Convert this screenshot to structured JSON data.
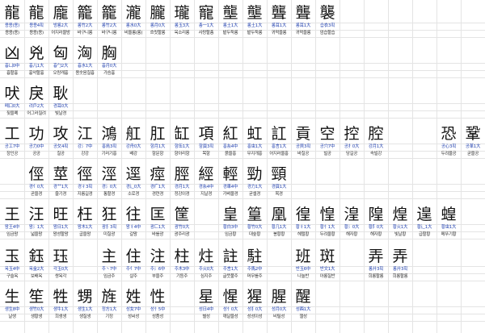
{
  "rows": [
    {
      "cells": [
        {
          "ch": "龍",
          "rd": "용용(용)",
          "mn": "용용(용)"
        },
        {
          "ch": "龍",
          "rd": "용용4획",
          "mn": "용용(용)"
        },
        {
          "ch": "龐",
          "rd": "방룡2大",
          "mn": "어지러울방"
        },
        {
          "ch": "籠",
          "rd": "롱竹2大",
          "mn": "바구니롱"
        },
        {
          "ch": "籠",
          "rd": "롱竹2大",
          "mn": "바구니롱"
        },
        {
          "ch": "瀧",
          "rd": "롱水0大",
          "mn": "비올롱(롱)"
        },
        {
          "ch": "朧",
          "rd": "롱月0大",
          "mn": "흐릿할롱"
        },
        {
          "ch": "瓏",
          "rd": "롱玉3大",
          "mn": "옥소리롱"
        },
        {
          "ch": "寵",
          "rd": "총一1大",
          "mn": "사랑할총"
        },
        {
          "ch": "壟",
          "rd": "롱土1大",
          "mn": "밭두둑롱"
        },
        {
          "ch": "壟",
          "rd": "롱土1大",
          "mn": "밭두둑롱"
        },
        {
          "ch": "聾",
          "rd": "롱耳1大",
          "mn": "귀먹을롱"
        },
        {
          "ch": "聾",
          "rd": "롱耳1大",
          "mn": "귀먹을롱"
        },
        {
          "ch": "襲",
          "rd": "습衣3획",
          "mn": "엄습할습"
        }
      ]
    },
    {
      "cells": [
        {
          "ch": "凶",
          "rd": "흉凵0中",
          "mn": "흉할흉"
        },
        {
          "ch": "兇",
          "rd": "흉儿1大",
          "mn": "흉악할흉"
        },
        {
          "ch": "匈",
          "rd": "흉勹2大",
          "mn": "오랑캐흉"
        },
        {
          "ch": "洶",
          "rd": "흉水1大",
          "mn": "용솟음칠흉"
        },
        {
          "ch": "胸",
          "rd": "흉月0大",
          "mn": "가슴흉"
        }
      ]
    },
    {
      "cells": [
        {
          "ch": "吠",
          "rd": "폐口0大",
          "mn": "짖을폐"
        },
        {
          "ch": "戾",
          "rd": "려戶2大",
          "mn": "어그러질려"
        },
        {
          "ch": "耿",
          "rd": "경耳0大",
          "mn": "빛날경"
        }
      ]
    },
    {
      "cells": [
        {
          "ch": "工",
          "rd": "공工7中",
          "mn": "장인공"
        },
        {
          "ch": "功",
          "rd": "공力0中",
          "mn": "공공"
        },
        {
          "ch": "攻",
          "rd": "공攵4획",
          "mn": "칠공"
        },
        {
          "ch": "江",
          "rd": "강氵7中",
          "mn": "강강"
        },
        {
          "ch": "鴻",
          "rd": "홍鳥3획",
          "mn": "기러기홍"
        },
        {
          "ch": "舡",
          "rd": "강舟0大",
          "mn": "배강"
        },
        {
          "ch": "肛",
          "rd": "항月1大",
          "mn": "항문항"
        },
        {
          "ch": "缸",
          "rd": "항缶1大",
          "mn": "항아리항"
        },
        {
          "ch": "項",
          "rd": "항頁3획",
          "mn": "목항"
        },
        {
          "ch": "紅",
          "rd": "홍糸4中",
          "mn": "붉을홍"
        },
        {
          "ch": "虹",
          "rd": "홍虫1大",
          "mn": "무지개홍"
        },
        {
          "ch": "訌",
          "rd": "홍言1大",
          "mn": "어지러울홍"
        },
        {
          "ch": "貢",
          "rd": "공貝3획",
          "mn": "바칠공"
        },
        {
          "ch": "空",
          "rd": "공穴7中",
          "mn": "빌공"
        },
        {
          "ch": "控",
          "rd": "공扌0大",
          "mn": "당길공"
        },
        {
          "ch": "腔",
          "rd": "강月1大",
          "mn": "속빌강"
        },
        {
          "ch": "",
          "rd": "",
          "mn": ""
        },
        {
          "ch": "",
          "rd": "",
          "mn": ""
        },
        {
          "ch": "恐",
          "rd": "공心3획",
          "mn": "두려울공"
        },
        {
          "ch": "鞏",
          "rd": "공革1大",
          "mn": "굳을공"
        }
      ]
    },
    {
      "cells": [
        {
          "ch": "",
          "rd": "",
          "mn": ""
        },
        {
          "ch": "俓",
          "rd": "경亻0大",
          "mn": "곧을경"
        },
        {
          "ch": "莖",
          "rd": "경艹1大",
          "mn": "줄기경"
        },
        {
          "ch": "徑",
          "rd": "경彳3획",
          "mn": "지름길경"
        },
        {
          "ch": "涇",
          "rd": "경氵0大",
          "mn": "통할경"
        },
        {
          "ch": "逕",
          "rd": "경辶0大",
          "mn": "소로경"
        },
        {
          "ch": "痙",
          "rd": "경疒1大",
          "mn": "경련경"
        },
        {
          "ch": "脛",
          "rd": "경月1大",
          "mn": "정강이경"
        },
        {
          "ch": "經",
          "rd": "경糸4中",
          "mn": "지날경"
        },
        {
          "ch": "輕",
          "rd": "경車4中",
          "mn": "가벼울경"
        },
        {
          "ch": "勁",
          "rd": "경力1大",
          "mn": "굳셀경"
        },
        {
          "ch": "頸",
          "rd": "경頁1大",
          "mn": "목경"
        }
      ]
    },
    {
      "cells": [
        {
          "ch": "王",
          "rd": "왕王4中",
          "mn": "임금왕"
        },
        {
          "ch": "汪",
          "rd": "왕氵1大",
          "mn": "넓을왕"
        },
        {
          "ch": "旺",
          "rd": "왕日1大",
          "mn": "왕성할왕"
        },
        {
          "ch": "枉",
          "rd": "왕木1大",
          "mn": "굽을왕"
        },
        {
          "ch": "狂",
          "rd": "광犭3획",
          "mn": "미칠광"
        },
        {
          "ch": "往",
          "rd": "왕彳4中",
          "mn": "갈왕"
        },
        {
          "ch": "匡",
          "rd": "광匚1大",
          "mn": "바를광"
        },
        {
          "ch": "筐",
          "rd": "광竹0大",
          "mn": "광주리광"
        },
        {
          "ch": "",
          "rd": "",
          "mn": ""
        },
        {
          "ch": "皇",
          "rd": "황白3中",
          "mn": "임금황"
        },
        {
          "ch": "篁",
          "rd": "황竹0大",
          "mn": "대숲황"
        },
        {
          "ch": "凰",
          "rd": "황几1大",
          "mn": "봉황황"
        },
        {
          "ch": "徨",
          "rd": "황彳1大",
          "mn": "헤맬황"
        },
        {
          "ch": "惶",
          "rd": "황忄1大",
          "mn": "두려울황"
        },
        {
          "ch": "湟",
          "rd": "황氵0大",
          "mn": "해자황"
        },
        {
          "ch": "隍",
          "rd": "황阝0大",
          "mn": "해자황"
        },
        {
          "ch": "煌",
          "rd": "황火1大",
          "mn": "빛날황"
        },
        {
          "ch": "遑",
          "rd": "황辶1大",
          "mn": "급할황"
        },
        {
          "ch": "蝗",
          "rd": "황虫1大",
          "mn": "메뚜기황"
        }
      ]
    },
    {
      "cells": [
        {
          "ch": "玉",
          "rd": "옥玉4中",
          "mn": "구슬옥"
        },
        {
          "ch": "鈺",
          "rd": "옥金2大",
          "mn": "보배옥"
        },
        {
          "ch": "珏",
          "rd": "각玉0大",
          "mn": "쌍옥각"
        },
        {
          "ch": "",
          "rd": "",
          "mn": ""
        },
        {
          "ch": "主",
          "rd": "주丶7中",
          "mn": "임금주"
        },
        {
          "ch": "住",
          "rd": "주亻7中",
          "mn": "살주"
        },
        {
          "ch": "注",
          "rd": "주氵6中",
          "mn": "부을주"
        },
        {
          "ch": "柱",
          "rd": "주木3中",
          "mn": "기둥주"
        },
        {
          "ch": "炷",
          "rd": "주火0大",
          "mn": "심지주"
        },
        {
          "ch": "註",
          "rd": "주言1大",
          "mn": "글뜻풀주"
        },
        {
          "ch": "駐",
          "rd": "주馬2中",
          "mn": "머무를주"
        },
        {
          "ch": "",
          "rd": "",
          "mn": ""
        },
        {
          "ch": "班",
          "rd": "반玉6中",
          "mn": "나눌반"
        },
        {
          "ch": "斑",
          "rd": "반文1大",
          "mn": "아롱질반"
        },
        {
          "ch": "",
          "rd": "",
          "mn": ""
        },
        {
          "ch": "弄",
          "rd": "롱廾3획",
          "mn": "희롱할롱"
        },
        {
          "ch": "弄",
          "rd": "롱廾3획",
          "mn": "희롱할롱"
        }
      ]
    },
    {
      "cells": [
        {
          "ch": "生",
          "rd": "생生8中",
          "mn": "날생"
        },
        {
          "ch": "笙",
          "rd": "생竹0大",
          "mn": "생황생"
        },
        {
          "ch": "牲",
          "rd": "생牛1大",
          "mn": "희생생"
        },
        {
          "ch": "甥",
          "rd": "생生1大",
          "mn": "생질생"
        },
        {
          "ch": "旌",
          "rd": "정方1大",
          "mn": "기정"
        },
        {
          "ch": "姓",
          "rd": "성女7中",
          "mn": "성씨성"
        },
        {
          "ch": "性",
          "rd": "성忄5中",
          "mn": "성품성"
        },
        {
          "ch": "",
          "rd": "",
          "mn": ""
        },
        {
          "ch": "星",
          "rd": "성日4中",
          "mn": "별성"
        },
        {
          "ch": "惺",
          "rd": "성忄0大",
          "mn": "깨달을성"
        },
        {
          "ch": "猩",
          "rd": "성犭0大",
          "mn": "성성이성"
        },
        {
          "ch": "腥",
          "rd": "성月0大",
          "mn": "비릴성"
        },
        {
          "ch": "醒",
          "rd": "성酉1大",
          "mn": "깰성"
        }
      ]
    }
  ]
}
